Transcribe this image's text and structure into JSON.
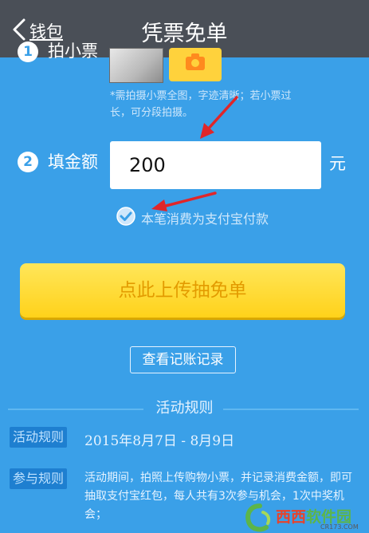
{
  "nav": {
    "back_label": "钱包",
    "title": "凭票免单"
  },
  "step1": {
    "number": "1",
    "label": "拍小票",
    "hint": "*需拍摄小票全图，字迹清晰；若小票过长，可分段拍摄。"
  },
  "step2": {
    "number": "2",
    "label": "填金额",
    "amount_value": "200",
    "unit": "元"
  },
  "payment_check": {
    "checked": true,
    "label": "本笔消费为支付宝付款"
  },
  "cta_label": "点此上传抽免单",
  "ledger_button_label": "查看记账记录",
  "rules": {
    "title": "活动规则",
    "period_tag": "活动规则",
    "period_text": "2015年8月7日 - 8月9日",
    "join_tag": "参与规则",
    "join_text": "活动期间，拍照上传购物小票，并记录消费金额，即可抽取支付宝红包，每人共有3次参与机会，1次中奖机会；"
  },
  "watermark": {
    "brand": "西西软件园",
    "brand_red_part": "西西",
    "brand_green_part": "软件园",
    "domain": "CR173.COM"
  },
  "colors": {
    "background": "#3aa0e8",
    "nav_bar": "#4a4f57",
    "cta": "#ffd21a",
    "cta_text": "#e39b00",
    "tag": "#1e7fd0",
    "annotation_arrow": "#e0262a"
  }
}
